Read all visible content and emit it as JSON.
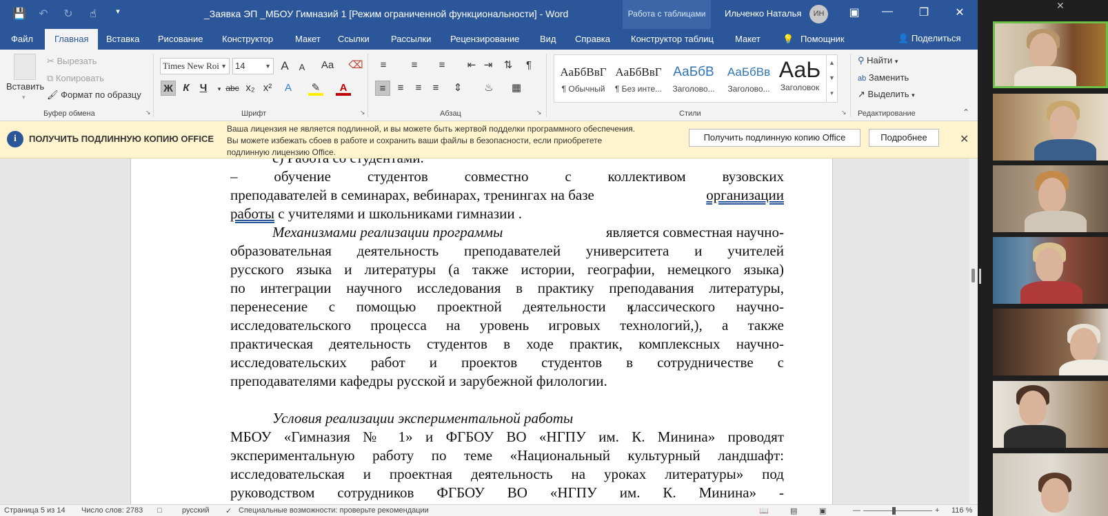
{
  "window": {
    "title": "_Заявка ЭП _МБОУ Гимназий 1 [Режим ограниченной функциональности]  -  Word",
    "context_tab": "Работа с таблицами",
    "user_name": "Ильченко Наталья",
    "user_initials": "ИН"
  },
  "ribbon_tabs": [
    "Файл",
    "Главная",
    "Вставка",
    "Рисование",
    "Конструктор",
    "Макет",
    "Ссылки",
    "Рассылки",
    "Рецензирование",
    "Вид",
    "Справка",
    "Конструктор таблиц",
    "Макет",
    "Помощник"
  ],
  "share_label": "Поделиться",
  "clipboard": {
    "paste": "Вставить",
    "cut": "Вырезать",
    "copy": "Копировать",
    "format_painter": "Формат по образцу",
    "label": "Буфер обмена"
  },
  "font": {
    "name": "Times New Roi",
    "size": "14",
    "label": "Шрифт",
    "grow": "A",
    "shrink": "A",
    "case": "Aa",
    "bold": "Ж",
    "italic": "К",
    "underline": "Ч",
    "strike": "abc",
    "subscript": "x₂",
    "superscript": "x²"
  },
  "paragraph": {
    "label": "Абзац"
  },
  "styles": {
    "label": "Стили",
    "items": [
      {
        "preview": "АаБбВвГ",
        "name": "¶ Обычный"
      },
      {
        "preview": "АаБбВвГ",
        "name": "¶ Без инте..."
      },
      {
        "preview": "АаБбВ",
        "name": "Заголово..."
      },
      {
        "preview": "АаБбВв",
        "name": "Заголово..."
      },
      {
        "preview": "АаЬ",
        "name": "Заголовок"
      }
    ]
  },
  "editing": {
    "find": "Найти",
    "replace": "Заменить",
    "select": "Выделить",
    "label": "Редактирование"
  },
  "infobar": {
    "title": "ПОЛУЧИТЬ ПОДЛИННУЮ КОПИЮ OFFICE",
    "line1": "Ваша лицензия не является подлинной, и вы можете быть жертвой подделки программного обеспечения.",
    "line2": "Вы можете избежать сбоев в работе и сохранить ваши файлы в безопасности, если приобретете",
    "line3": "подлинную лицензию Office.",
    "button_primary": "Получить подлинную копию Office",
    "button_more": "Подробнее"
  },
  "document": {
    "lines": [
      "с) Работа со студентами.",
      "–     обучение студентов совместно с коллективом вузовских",
      "преподавателей в семинарах, вебинарах, тренингах на базе",
      "организации",
      "работы",
      " с учителями и школьниками гимназии .",
      "Механизмами реализации программы",
      "является совместная научно-",
      "образовательная деятельность преподавателей университета и учителей",
      "русского языка и литературы (а также истории, географии, немецкого языка)",
      "по  интеграции научного исследования в практику преподавания литературы,",
      "перенесение с помощью проектной деятельности классического научно-",
      "исследовательского процесса    на уровень игровых технологий,), а также",
      "практическая деятельность студентов в ходе практик, комплексных научно-",
      "исследовательских работ и проектов студентов в сотрудничестве с",
      "преподавателями кафедры русской и зарубежной филологии.",
      "Условия реализации экспериментальной работы",
      "МБОУ «Гимназия № 1» и ФГБОУ ВО «НГПУ им. К. Минина» проводят",
      "экспериментальную работу по теме  «Национальный культурный ландшафт:",
      "исследовательская и проектная деятельность на уроках литературы» под",
      "руководством   сотрудников ФГБОУ ВО «НГПУ им. К. Минина» -"
    ]
  },
  "statusbar": {
    "page": "Страница 5 из 14",
    "words": "Число слов: 2783",
    "language": "русский",
    "accessibility": "Специальные возможности: проверьте рекомендации",
    "zoom": "116 %"
  }
}
